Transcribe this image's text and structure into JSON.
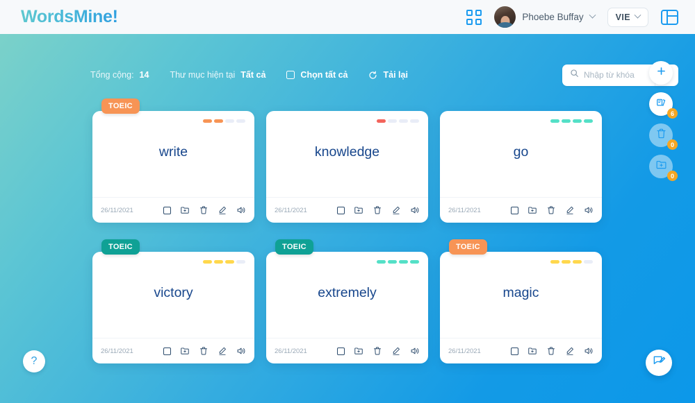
{
  "header": {
    "logo": "WordsMine!",
    "grid_icon": "grid-apps-icon",
    "user_name": "Phoebe Buffay",
    "user_chevron_icon": "chevron-down-icon",
    "language": "VIE",
    "language_chevron_icon": "chevron-down-icon",
    "panel_icon": "layout-panel-icon"
  },
  "toolbar": {
    "total_label": "Tổng cộng:",
    "total_count": "14",
    "folder_label": "Thư mục hiện tại",
    "folder_value": "Tất cả",
    "select_all_label": "Chọn tất cả",
    "select_all_icon": "checkbox-icon",
    "reload_label": "Tải lại",
    "reload_icon": "refresh-icon"
  },
  "search": {
    "placeholder": "Nhập từ khóa",
    "value": "",
    "search_icon": "search-icon",
    "submit_icon": "arrow-right-icon"
  },
  "cards": [
    {
      "tag": "TOEIC",
      "tag_color": "orange",
      "word": "write",
      "date": "26/11/2021",
      "progress": [
        "on-orange",
        "on-orange",
        "off",
        "off"
      ]
    },
    {
      "tag": null,
      "tag_color": null,
      "word": "knowledge",
      "date": "26/11/2021",
      "progress": [
        "on-red",
        "off",
        "off",
        "off"
      ]
    },
    {
      "tag": null,
      "tag_color": null,
      "word": "go",
      "date": "26/11/2021",
      "progress": [
        "on-teal",
        "on-teal",
        "on-teal",
        "on-teal"
      ]
    },
    {
      "tag": "TOEIC",
      "tag_color": "teal",
      "word": "victory",
      "date": "26/11/2021",
      "progress": [
        "on-yellow",
        "on-yellow",
        "on-yellow",
        "off"
      ]
    },
    {
      "tag": "TOEIC",
      "tag_color": "teal",
      "word": "extremely",
      "date": "26/11/2021",
      "progress": [
        "on-teal",
        "on-teal",
        "on-teal",
        "on-teal"
      ]
    },
    {
      "tag": "TOEIC",
      "tag_color": "orange",
      "word": "magic",
      "date": "26/11/2021",
      "progress": [
        "on-yellow",
        "on-yellow",
        "on-yellow",
        "off"
      ]
    }
  ],
  "card_actions": {
    "select_icon": "checkbox-icon",
    "move_icon": "folder-add-icon",
    "delete_icon": "trash-icon",
    "edit_icon": "pencil-icon",
    "speak_icon": "speaker-icon"
  },
  "fabs": [
    {
      "icon": "plus-icon",
      "badge": null,
      "dim": false
    },
    {
      "icon": "flashcards-icon",
      "badge": "6",
      "dim": false
    },
    {
      "icon": "trash-icon",
      "badge": "0",
      "dim": true
    },
    {
      "icon": "folder-add-icon",
      "badge": "0",
      "dim": true
    }
  ],
  "help_button": {
    "icon": "question-mark-icon",
    "label": "?"
  },
  "chat_button": {
    "icon": "feedback-edit-icon"
  },
  "colors": {
    "accent_blue": "#1b9bf0",
    "word_navy": "#17468c",
    "tag_orange": "#f79455",
    "tag_teal": "#0fa195",
    "badge_amber": "#f5a623",
    "progress_red": "#f3645c",
    "progress_teal": "#54e0c7",
    "progress_yellow": "#ffd84d",
    "bg_from": "#7fd3c8",
    "bg_to": "#0c98e9"
  }
}
